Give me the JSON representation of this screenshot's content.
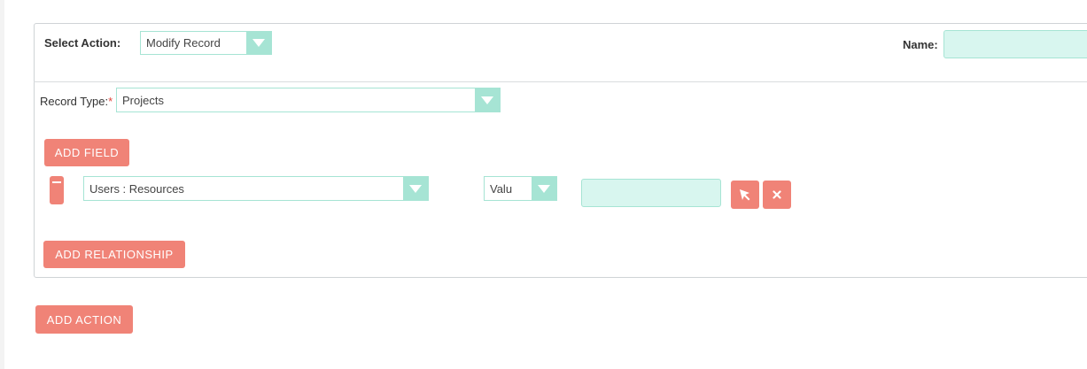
{
  "action": {
    "select_label": "Select Action:",
    "select_value": "Modify Record",
    "name_label": "Name:",
    "name_value": ""
  },
  "record": {
    "type_label": "Record Type:",
    "required_marker": "*",
    "type_value": "Projects"
  },
  "buttons": {
    "add_field": "ADD FIELD",
    "add_relationship": "ADD RELATIONSHIP",
    "add_action": "ADD ACTION"
  },
  "field_row": {
    "field_value": "Users : Resources",
    "value_type": "Valu",
    "value_input": ""
  },
  "icons": {
    "remove": "minus-icon",
    "select": "cursor-arrow-icon",
    "clear": "x-icon"
  },
  "colors": {
    "accent": "#f08377",
    "input_bg": "#d8f6ef",
    "input_border": "#a6e4d4"
  }
}
